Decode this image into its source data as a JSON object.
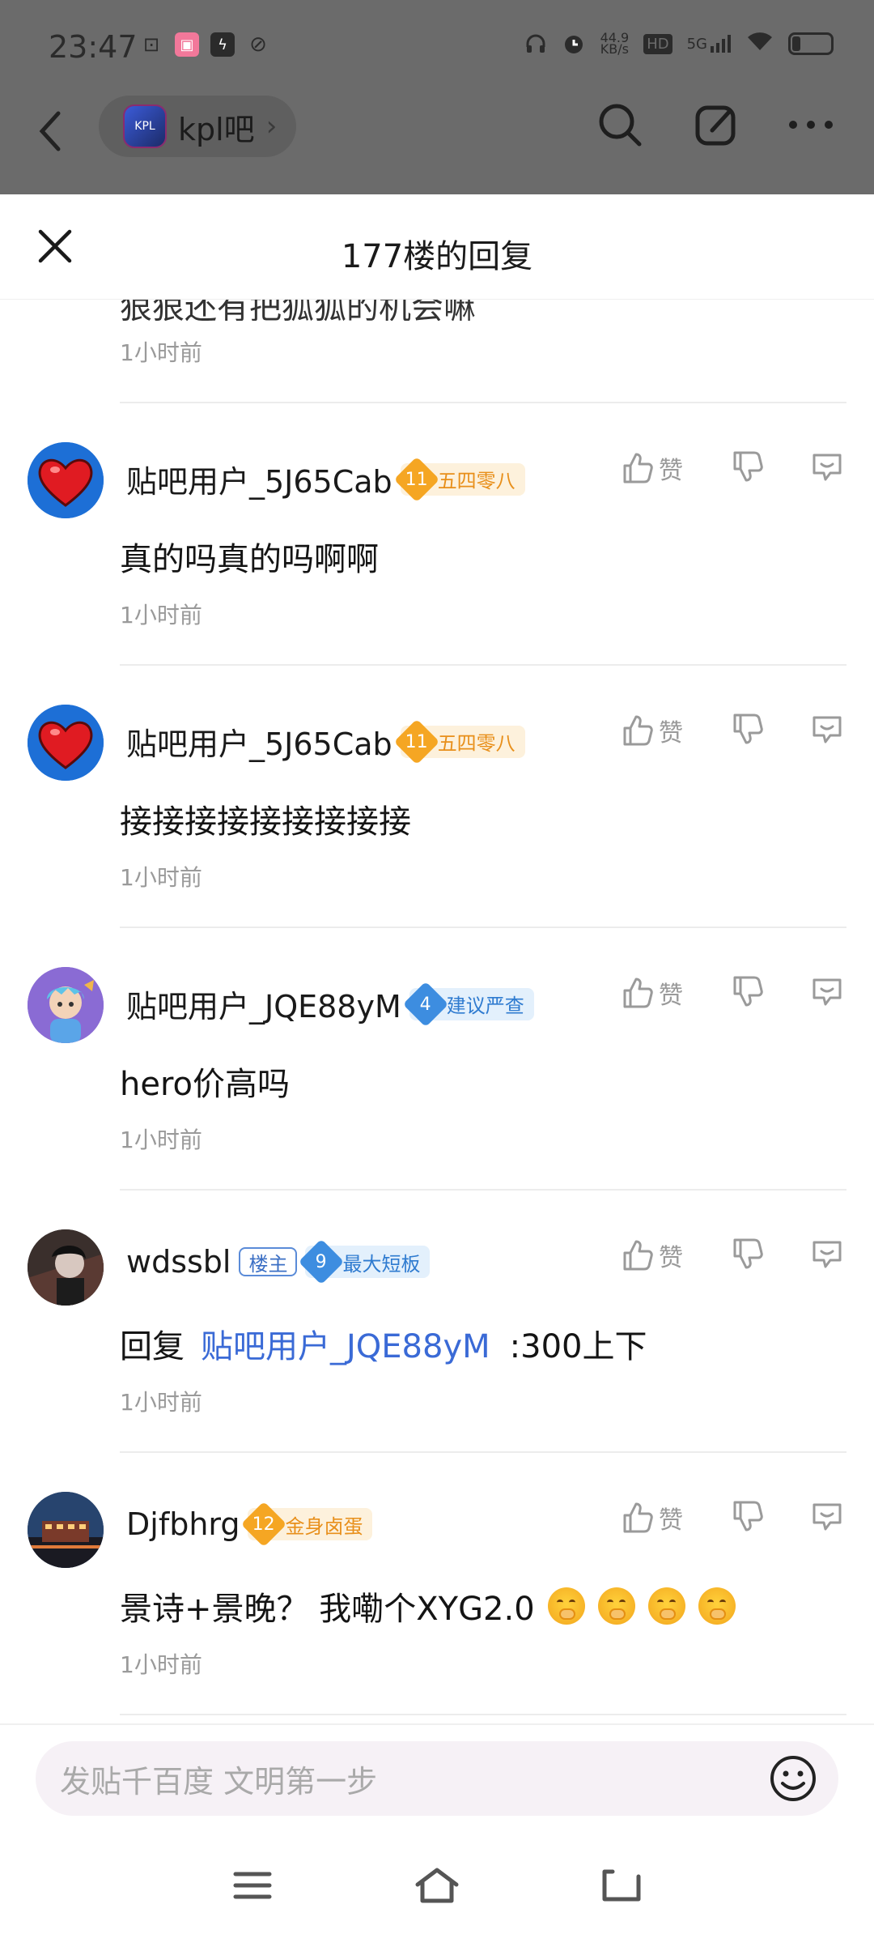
{
  "status_bar": {
    "time": "23:47",
    "net_speed": "44.9",
    "net_unit": "KB/s",
    "hd": "HD",
    "signal": "5G"
  },
  "forum": {
    "name": "kpl吧",
    "logo_text": "KPL"
  },
  "sheet": {
    "title": "177楼的回复"
  },
  "partial_reply": {
    "text": "狠狠还有把狐狐的机会嘛",
    "time": "1小时前"
  },
  "replies": [
    {
      "username": "贴吧用户_5J65Cab",
      "level": "11",
      "badge": "五四零八",
      "badge_color": "#f5a623",
      "content": "真的吗真的吗啊啊",
      "time": "1小时前",
      "like_label": "赞"
    },
    {
      "username": "贴吧用户_5J65Cab",
      "level": "11",
      "badge": "五四零八",
      "badge_color": "#f5a623",
      "content": "接接接接接接接接接",
      "time": "1小时前",
      "like_label": "赞"
    },
    {
      "username": "贴吧用户_JQE88yM",
      "level": "4",
      "badge": "建议严查",
      "badge_color": "#3d8de0",
      "content": "hero价高吗",
      "time": "1小时前",
      "like_label": "赞"
    },
    {
      "username": "wdssbl",
      "owner_tag": "楼主",
      "level": "9",
      "badge": "最大短板",
      "badge_color": "#3d8de0",
      "content_prefix": "回复",
      "reply_to": "贴吧用户_JQE88yM",
      "content": ":300上下",
      "time": "1小时前",
      "like_label": "赞"
    },
    {
      "username": "Djfbhrg",
      "level": "12",
      "badge": "金身卤蛋",
      "badge_color": "#f5a623",
      "content": "景诗+景晚？ 我嘞个XYG2.0",
      "emoji_count": 4,
      "emoji": "smirk-face-emoji",
      "time": "1小时前",
      "like_label": "赞"
    }
  ],
  "input": {
    "placeholder": "发贴千百度 文明第一步"
  },
  "colors": {
    "link_blue": "#3a6ad6",
    "gold_badge": "#f5a623",
    "blue_badge": "#3d8de0",
    "time_grey": "#9a9a9a"
  }
}
